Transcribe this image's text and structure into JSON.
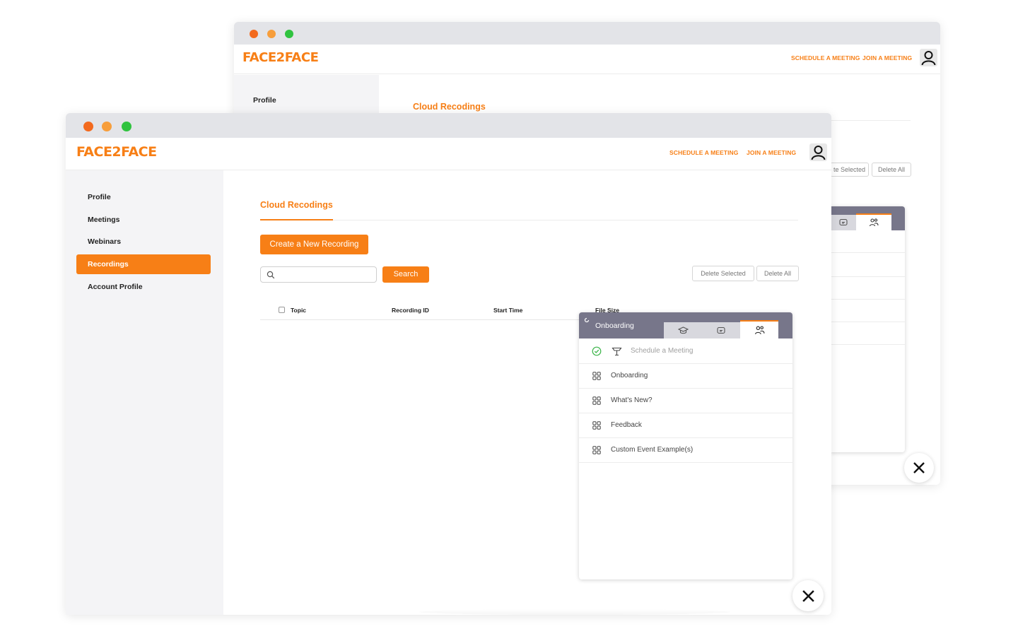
{
  "app": {
    "logo": "FACE2FACE",
    "nav": {
      "schedule": "SCHEDULE A MEETING",
      "join": "JOIN A MEETING"
    },
    "colors": {
      "accent": "#f77f16",
      "traffic_red": "#f36a1e",
      "traffic_yellow": "#f79e3b",
      "traffic_green": "#30c33f",
      "panel_header": "#77768a"
    }
  },
  "sidebar": {
    "items": [
      {
        "label": "Profile"
      },
      {
        "label": "Meetings"
      },
      {
        "label": "Webinars"
      },
      {
        "label": "Recordings",
        "active": true
      },
      {
        "label": "Account Profile"
      }
    ]
  },
  "main": {
    "title": "Cloud Recodings",
    "create_button": "Create a New Recording",
    "search_button": "Search",
    "search_placeholder": "",
    "delete_selected": "Delete Selected",
    "delete_all": "Delete All",
    "back_delete_selected": "te Selected",
    "table_headers": {
      "topic": "Topic",
      "recording_id": "Recording ID",
      "start_time": "Start Time",
      "file_size": "File Size"
    }
  },
  "onboarding": {
    "title": "Onboarding",
    "tabs": [
      {
        "icon": "graduation-cap-icon"
      },
      {
        "icon": "chat-bubbles-icon"
      },
      {
        "icon": "users-icon",
        "active": true
      }
    ],
    "items": [
      {
        "label": "Schedule a Meeting",
        "done": true,
        "icon": "lectern-icon"
      },
      {
        "label": "Onboarding",
        "icon": "grid-icon"
      },
      {
        "label": "What's New?",
        "icon": "grid-icon"
      },
      {
        "label": "Feedback",
        "icon": "grid-icon"
      },
      {
        "label": "Custom Event Example(s)",
        "icon": "grid-icon"
      }
    ]
  }
}
